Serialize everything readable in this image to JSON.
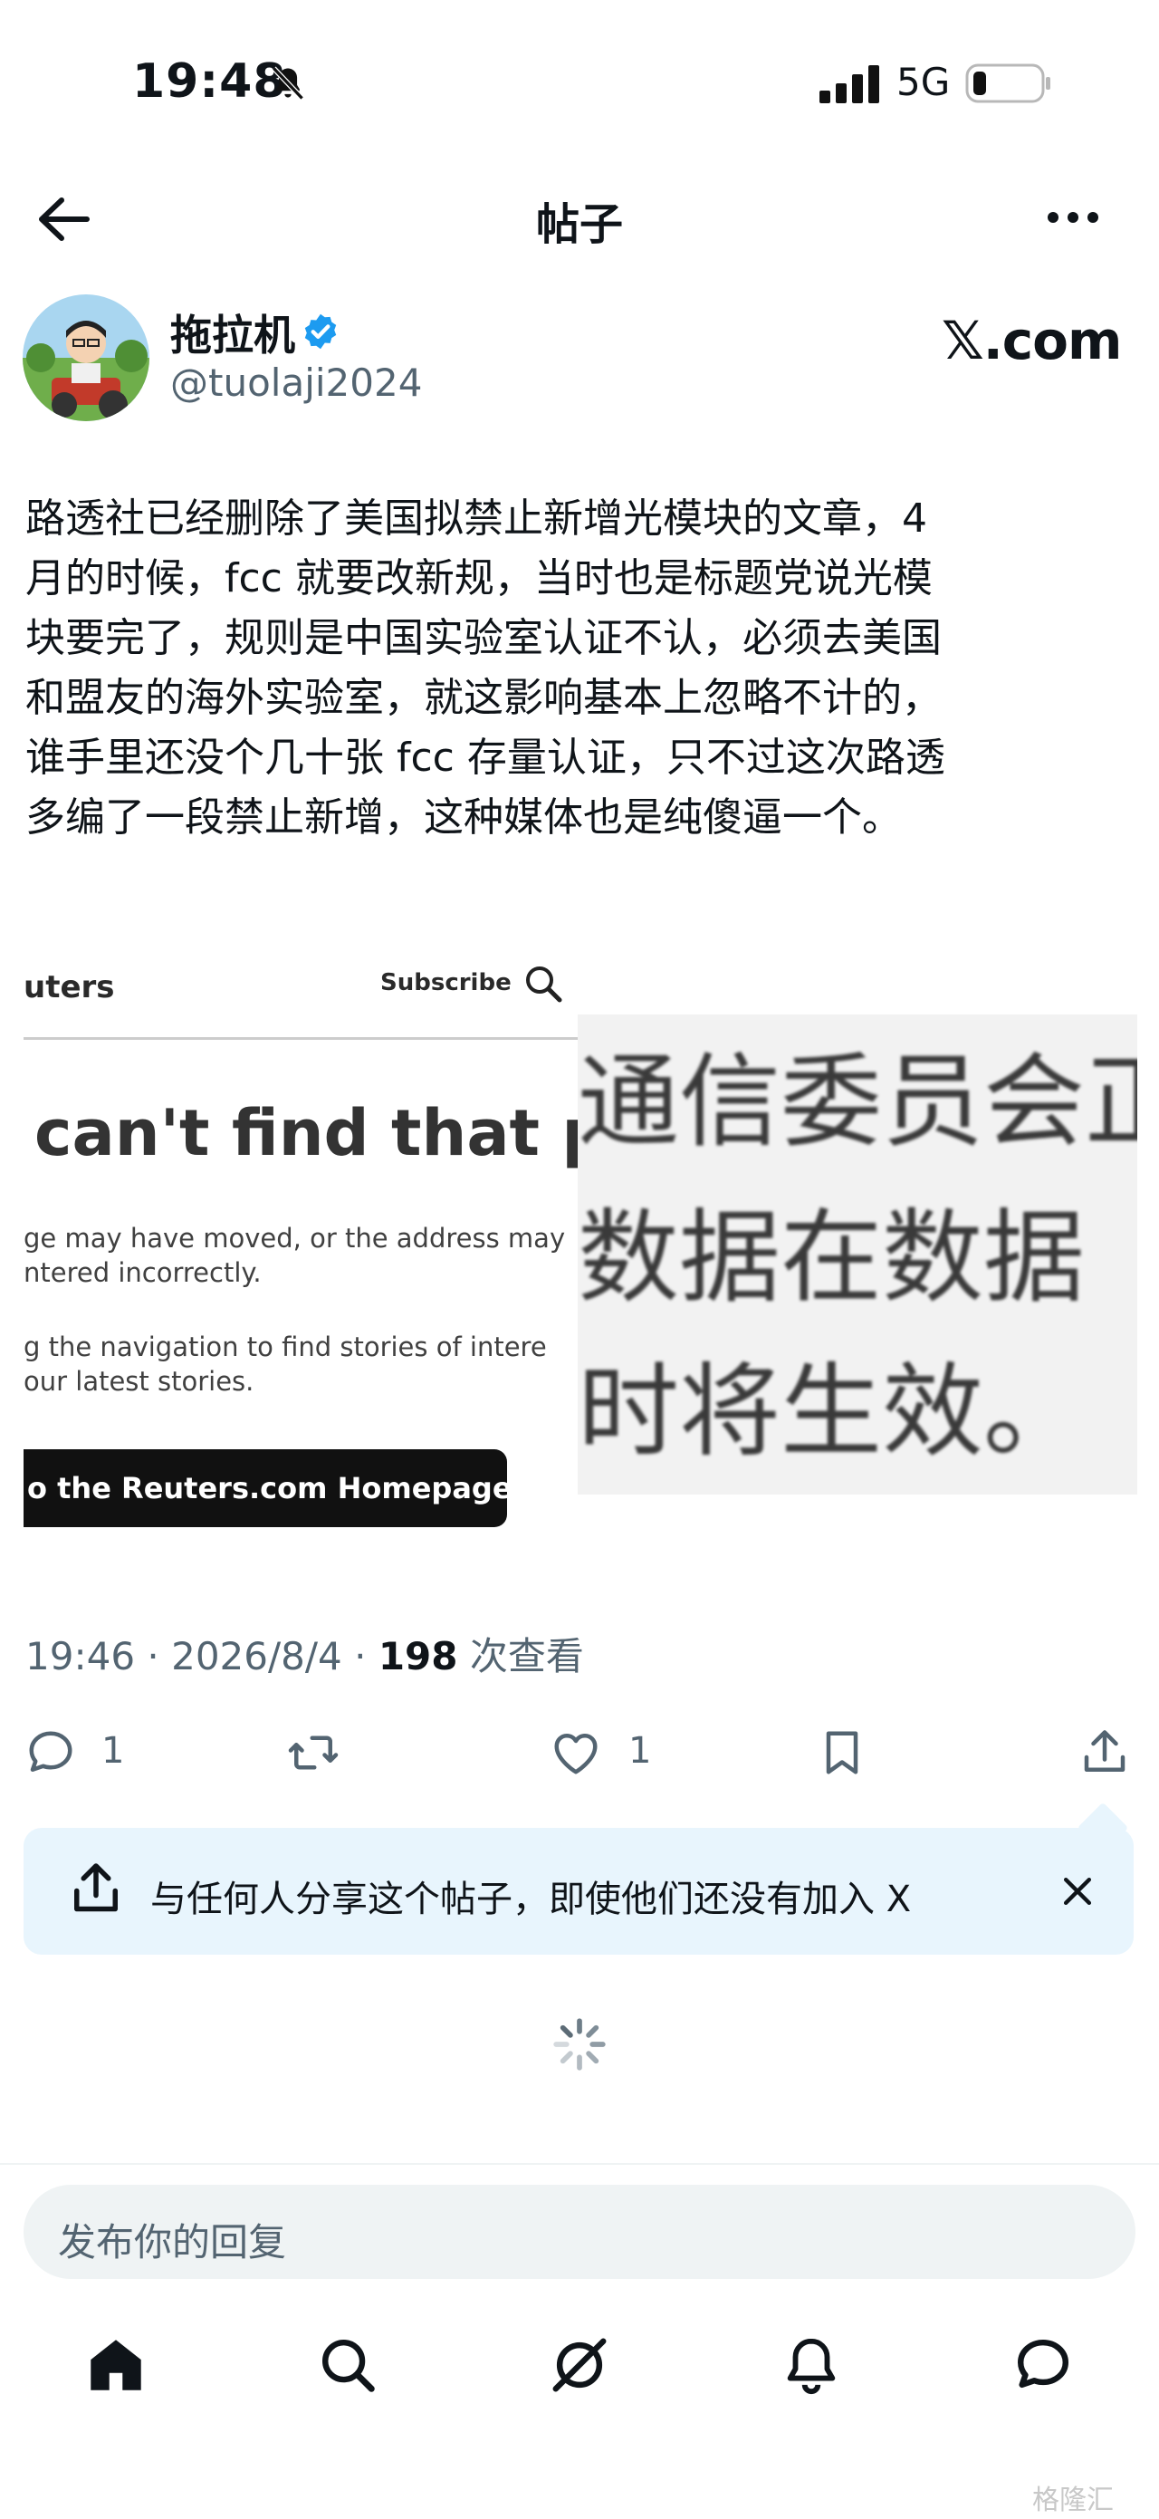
{
  "status_bar": {
    "time": "19:48",
    "network": "5G"
  },
  "nav": {
    "title": "帖子"
  },
  "author": {
    "name": "拖拉机",
    "handle": "@tuolaji2024",
    "site_tag": "𝕏.com"
  },
  "post": {
    "text_lines": [
      "路透社已经删除了美国拟禁止新增光模块的文章，4",
      "月的时候，fcc 就要改新规，当时也是标题党说光模",
      "块要完了，规则是中国实验室认证不认，必须去美国",
      "和盟友的海外实验室，就这影响基本上忽略不计的，",
      "谁手里还没个几十张 fcc 存量认证，只不过这次路透",
      "多编了一段禁止新增，这种媒体也是纯傻逼一个。"
    ]
  },
  "media": {
    "reuters": {
      "brand": "uters",
      "subscribe": "Subscribe",
      "heading": "can't find that pa",
      "para1_line1": "ge may have moved, or the address may",
      "para1_line2": "ntered incorrectly.",
      "para2_line1": "g the navigation to find stories of intere",
      "para2_line2": "our latest stories.",
      "home_button": "o the Reuters.com Homepage"
    },
    "zoomed_lines": [
      "通信委员会正",
      "数据在数据",
      "时将生效。"
    ]
  },
  "meta": {
    "time": "19:46",
    "date": "2026/8/4",
    "views": "198",
    "views_label": "次查看"
  },
  "actions": {
    "replies": "1",
    "likes": "1"
  },
  "share_banner": {
    "text": "与任何人分享这个帖子，即使他们还没有加入 X"
  },
  "reply_box": {
    "placeholder": "发布你的回复"
  },
  "watermark": "格隆汇",
  "colors": {
    "accent": "#1d9bf0",
    "text": "#0f1419",
    "secondary": "#536471",
    "banner_bg": "#e8f5fd"
  }
}
